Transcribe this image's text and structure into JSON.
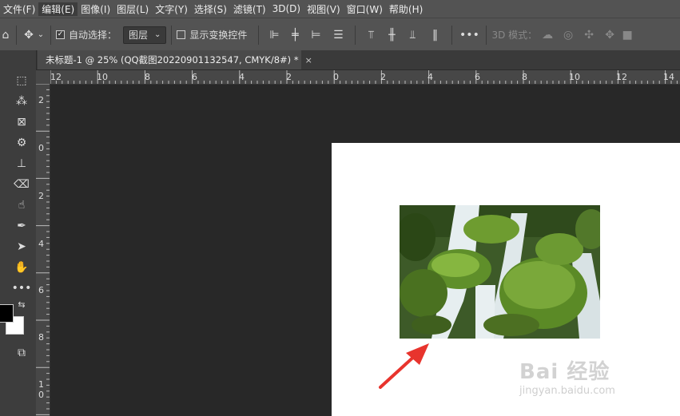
{
  "menu": [
    "文件(F)",
    "编辑(E)",
    "图像(I)",
    "图层(L)",
    "文字(Y)",
    "选择(S)",
    "滤镜(T)",
    "3D(D)",
    "视图(V)",
    "窗口(W)",
    "帮助(H)"
  ],
  "options": {
    "auto_select_label": "自动选择：",
    "layer_select_value": "图层",
    "show_transform_label": "显示变换控件",
    "mode_3d_label": "3D 模式：",
    "more": "•••"
  },
  "document_tab": {
    "title": "未标题-1 @ 25% (QQ截图20220901132547, CMYK/8#) *",
    "close": "×"
  },
  "ruler_h": [
    "12",
    "10",
    "8",
    "6",
    "4",
    "2",
    "0",
    "2",
    "4",
    "6",
    "8",
    "10",
    "12",
    "14"
  ],
  "ruler_v": [
    "2",
    "0",
    "2",
    "4",
    "6",
    "8",
    "1",
    "0"
  ],
  "watermark": {
    "brand": "Bai 经验",
    "url": "jingyan.baidu.com"
  },
  "colors": {
    "menubar": "#535353",
    "panel": "#3d3d3d",
    "canvas": "#282828",
    "document": "#ffffff",
    "arrow": "#e8342d"
  }
}
